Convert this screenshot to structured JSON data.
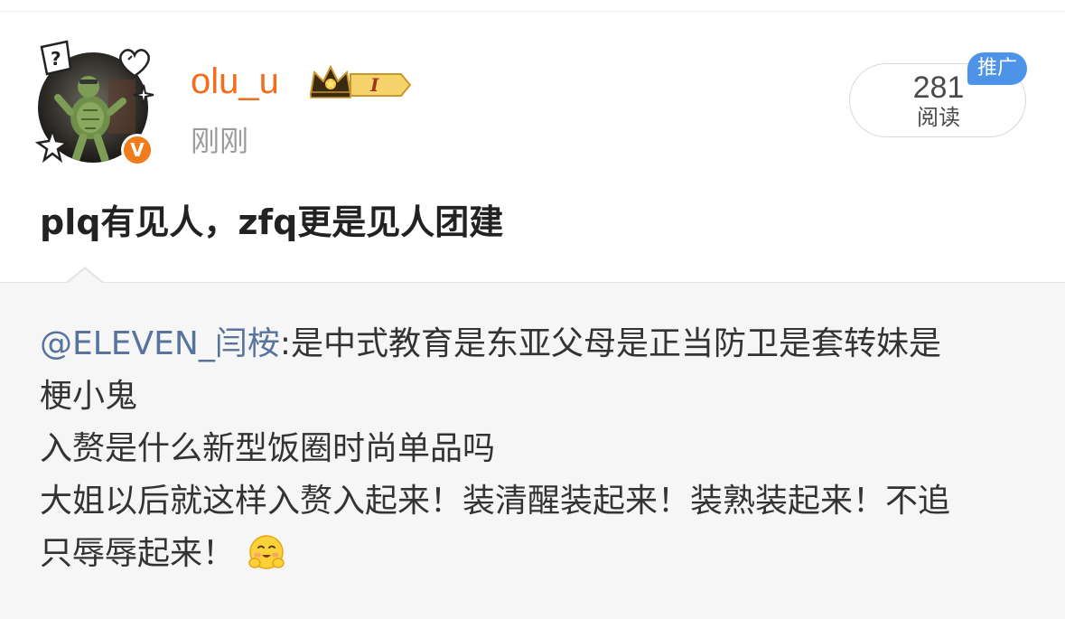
{
  "post": {
    "author": {
      "username": "olu_u",
      "verified_badge": "V",
      "verified_color": "#f07c1b",
      "username_color": "#f06e1d",
      "level_badge": "I",
      "level_icon": "crown-level-icon"
    },
    "timestamp": "刚刚",
    "stats": {
      "read_count": "281",
      "read_label": "阅读",
      "promo_tag": "推广",
      "promo_color": "#4d94e8"
    },
    "text": "plq有见人，zfq更是见人团建"
  },
  "repost": {
    "mention": "@ELEVEN_闫桉",
    "mention_color": "#57739e",
    "lines": [
      ":是中式教育是东亚父母是正当防卫是套转妹是",
      "梗小鬼",
      "入赘是什么新型饭圈时尚单品吗",
      "大姐以后就这样入赘入起来！装清醒装起来！装熟装起来！不追",
      "只辱辱起来！"
    ],
    "emoji": "smiling-face-with-hands-icon"
  }
}
